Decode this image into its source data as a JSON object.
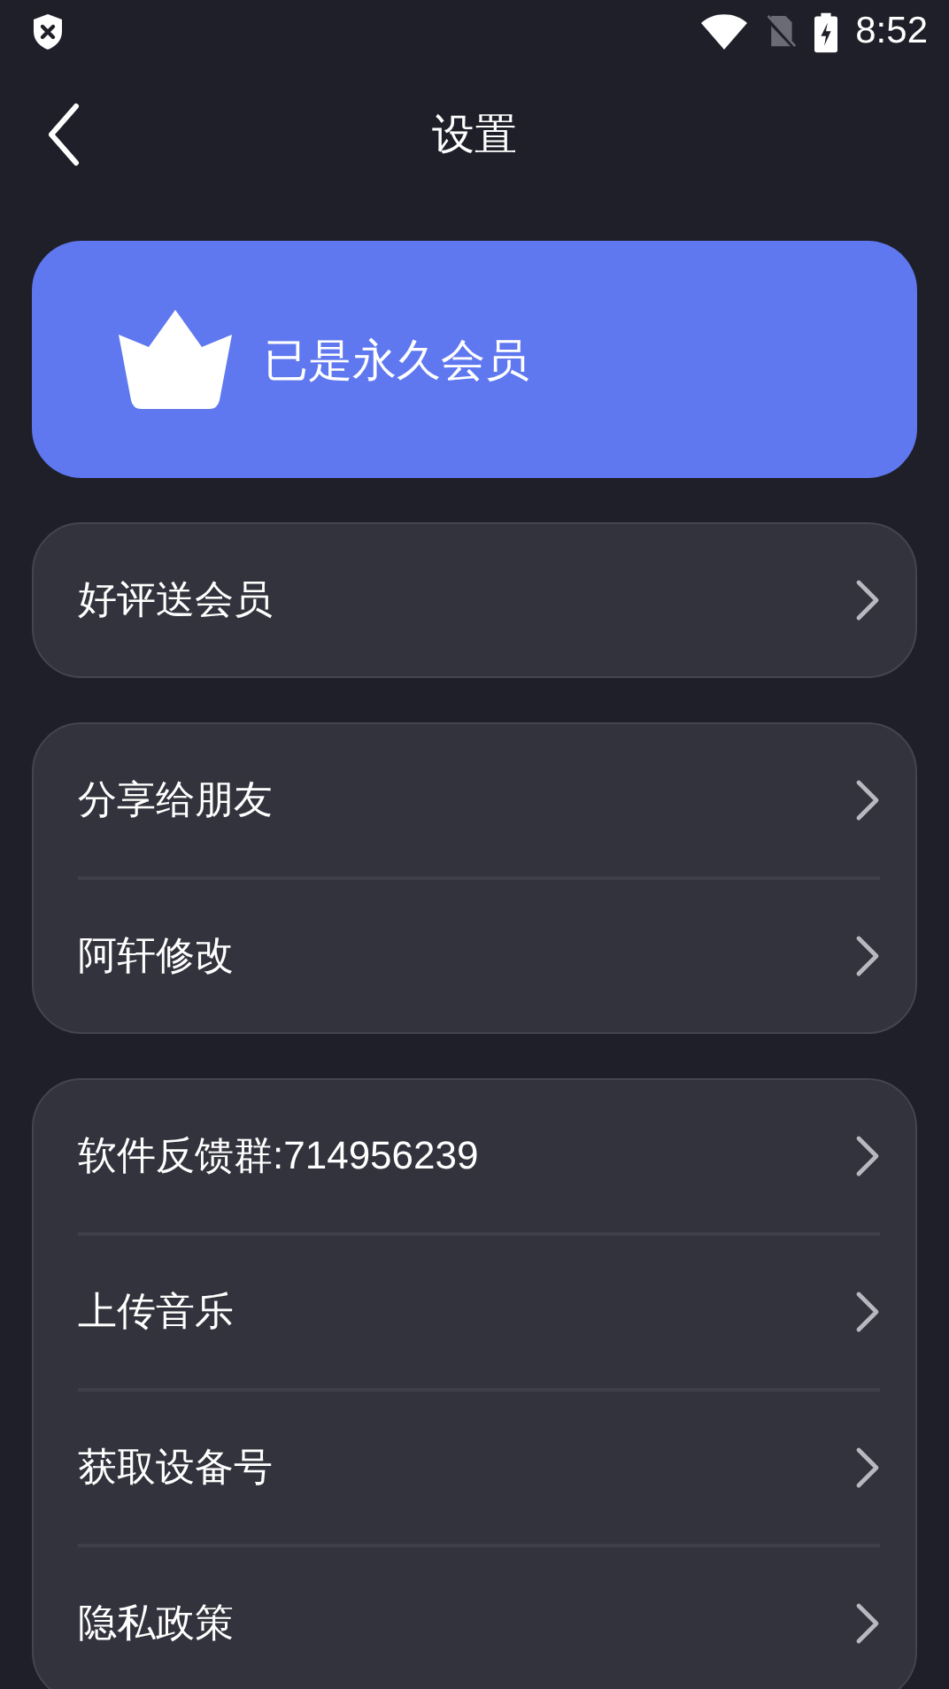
{
  "status_bar": {
    "time": "8:52"
  },
  "header": {
    "title": "设置"
  },
  "member_card": {
    "label": "已是永久会员"
  },
  "groups": [
    {
      "items": [
        {
          "label": "好评送会员"
        }
      ]
    },
    {
      "items": [
        {
          "label": "分享给朋友"
        },
        {
          "label": "阿轩修改"
        }
      ]
    },
    {
      "items": [
        {
          "label": "软件反馈群:714956239"
        },
        {
          "label": "上传音乐"
        },
        {
          "label": "获取设备号"
        },
        {
          "label": "隐私政策"
        }
      ]
    }
  ]
}
